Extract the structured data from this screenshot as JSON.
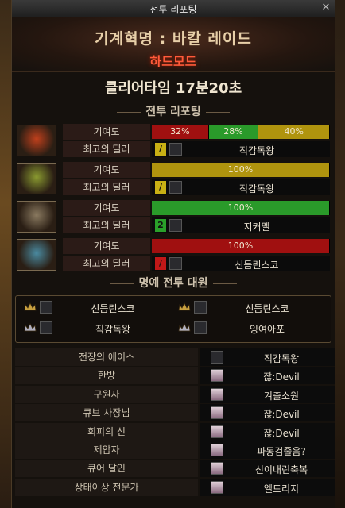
{
  "window": {
    "title": "전투 리포팅",
    "close_label": "✕"
  },
  "dungeon": {
    "name": "기계혁명 : 바칼 레이드",
    "mode": "하드모드"
  },
  "clear_time": "클리어타임  17분20초",
  "section_report": "전투 리포팅",
  "section_honor": "명예 전투 대원",
  "labels": {
    "contribution": "기여도",
    "best_dealer": "최고의 딜러"
  },
  "parties": [
    {
      "portrait_color": "#c0401c",
      "segments": [
        {
          "text": "32%",
          "value": 32,
          "color": "#a01010"
        },
        {
          "text": "28%",
          "value": 28,
          "color": "#2a9a2a"
        },
        {
          "text": "40%",
          "value": 40,
          "color": "#b0940e"
        }
      ],
      "dealer": {
        "badge": "/",
        "badge_color": "#c8b014",
        "name": "직감독왕"
      }
    },
    {
      "portrait_color": "#8a9a30",
      "segments": [
        {
          "text": "100%",
          "value": 100,
          "color": "#b0940e"
        }
      ],
      "dealer": {
        "badge": "/",
        "badge_color": "#c8b014",
        "name": "직감독왕"
      }
    },
    {
      "portrait_color": "#8a7a60",
      "segments": [
        {
          "text": "100%",
          "value": 100,
          "color": "#2a9a2a"
        }
      ],
      "dealer": {
        "badge": "2",
        "badge_color": "#2aa02a",
        "name": "지커멜"
      }
    },
    {
      "portrait_color": "#4a8aa0",
      "segments": [
        {
          "text": "100%",
          "value": 100,
          "color": "#a01010"
        }
      ],
      "dealer": {
        "badge": "/",
        "badge_color": "#c01818",
        "name": "신듬린스코"
      }
    }
  ],
  "honor_members": [
    {
      "name": "신듬린스코",
      "crown_color": "#c8a040"
    },
    {
      "name": "신듬린스코",
      "crown_color": "#c8a040"
    },
    {
      "name": "직감독왕",
      "crown_color": "#b0b0c0"
    },
    {
      "name": "잉여아포",
      "crown_color": "#b0b0c0"
    }
  ],
  "honor_awards": [
    {
      "title": "전장의 에이스",
      "name": "직감독왕"
    },
    {
      "title": "한방",
      "name": "잖:Devil"
    },
    {
      "title": "구원자",
      "name": "겨출소원"
    },
    {
      "title": "큐브 사장님",
      "name": "잖:Devil"
    },
    {
      "title": "회피의 신",
      "name": "잖:Devil"
    },
    {
      "title": "제압자",
      "name": "파동검줄음?"
    },
    {
      "title": "큐어 달인",
      "name": "신이내린축복"
    },
    {
      "title": "상태이상 전문가",
      "name": "엘드리지"
    }
  ]
}
